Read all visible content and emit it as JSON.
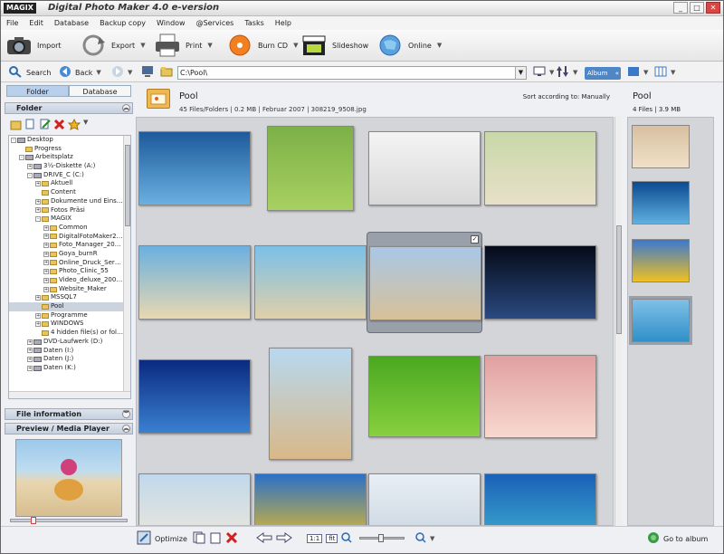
{
  "app": {
    "logo": "MAGIX",
    "title": "Digital Photo Maker 4.0 e-version",
    "controls": [
      "_",
      "□",
      "✕"
    ]
  },
  "menu": [
    "File",
    "Edit",
    "Database",
    "Backup copy",
    "Window",
    "@Services",
    "Tasks",
    "Help"
  ],
  "toolbar": {
    "import": "Import",
    "export": "Export",
    "print": "Print",
    "burn": "Burn CD",
    "slideshow": "Slideshow",
    "online": "Online"
  },
  "nav": {
    "search": "Search",
    "back": "Back",
    "path": "C:\\Pool\\",
    "album": "Album"
  },
  "left": {
    "tab_folder": "Folder",
    "tab_database": "Database",
    "folder_panel": "Folder",
    "file_info": "File information",
    "preview_panel": "Preview / Media Player"
  },
  "tree": [
    {
      "label": "Desktop",
      "d": 0,
      "t": "d",
      "e": "-"
    },
    {
      "label": "Progress",
      "d": 1,
      "t": "f",
      "e": ""
    },
    {
      "label": "Arbeitsplatz",
      "d": 1,
      "t": "d",
      "e": "-"
    },
    {
      "label": "3½-Diskette (A:)",
      "d": 2,
      "t": "r",
      "e": "+"
    },
    {
      "label": "DRIVE_C (C:)",
      "d": 2,
      "t": "r",
      "e": "-"
    },
    {
      "label": "Aktuell",
      "d": 3,
      "t": "f",
      "e": "+"
    },
    {
      "label": "Content",
      "d": 3,
      "t": "f",
      "e": ""
    },
    {
      "label": "Dokumente und Eins…",
      "d": 3,
      "t": "f",
      "e": "+"
    },
    {
      "label": "Fotos Präsi",
      "d": 3,
      "t": "f",
      "e": "+"
    },
    {
      "label": "MAGIX",
      "d": 3,
      "t": "f",
      "e": "-"
    },
    {
      "label": "Common",
      "d": 4,
      "t": "f",
      "e": "+"
    },
    {
      "label": "DigitalFotoMaker2…",
      "d": 4,
      "t": "f",
      "e": "+"
    },
    {
      "label": "Foto_Manager_20…",
      "d": 4,
      "t": "f",
      "e": "+"
    },
    {
      "label": "Goya_burnR",
      "d": 4,
      "t": "f",
      "e": "+"
    },
    {
      "label": "Online_Druck_Ser…",
      "d": 4,
      "t": "f",
      "e": "+"
    },
    {
      "label": "Photo_Clinic_55",
      "d": 4,
      "t": "f",
      "e": "+"
    },
    {
      "label": "Video_deluxe_200…",
      "d": 4,
      "t": "f",
      "e": "+"
    },
    {
      "label": "Website_Maker",
      "d": 4,
      "t": "f",
      "e": "+"
    },
    {
      "label": "MSSQL7",
      "d": 3,
      "t": "f",
      "e": "+"
    },
    {
      "label": "Pool",
      "d": 3,
      "t": "f",
      "e": "",
      "sel": true
    },
    {
      "label": "Programme",
      "d": 3,
      "t": "f",
      "e": "+"
    },
    {
      "label": "WINDOWS",
      "d": 3,
      "t": "f",
      "e": "+"
    },
    {
      "label": "4 hidden file(s) or fol…",
      "d": 3,
      "t": "f",
      "e": ""
    },
    {
      "label": "DVD-Laufwerk (D:)",
      "d": 2,
      "t": "r",
      "e": "+"
    },
    {
      "label": "Daten (I:)",
      "d": 2,
      "t": "r",
      "e": "+"
    },
    {
      "label": "Daten (J:)",
      "d": 2,
      "t": "r",
      "e": "+"
    },
    {
      "label": "Daten (K:)",
      "d": 2,
      "t": "r",
      "e": "+"
    }
  ],
  "main": {
    "folder": "Pool",
    "info": "45 Files/Folders | 0.2 MB | Februar 2007 | 308219_9508.jpg",
    "sort": "Sort according to: Manually",
    "checkmark": "✓"
  },
  "album": {
    "title": "Pool",
    "info": "4 Files | 3.9 MB"
  },
  "thumbs": [
    {
      "n": "dolphin",
      "c": "#1d5a9c",
      "c2": "#6ab0e0"
    },
    {
      "n": "sheep",
      "c": "#7cb048",
      "c2": "#a8d060"
    },
    {
      "n": "rose-bottle",
      "c": "#f4f4f4",
      "c2": "#d8d8d8"
    },
    {
      "n": "girl-grass",
      "c": "#c8d8a8",
      "c2": "#e8e0c8"
    },
    {
      "n": "beach",
      "c": "#6ab0e0",
      "c2": "#e8d8b0"
    },
    {
      "n": "family",
      "c": "#7ac0e8",
      "c2": "#e0d0a8"
    },
    {
      "n": "child-sand",
      "c": "#a8c8e8",
      "c2": "#d8c098"
    },
    {
      "n": "earth",
      "c": "#050a18",
      "c2": "#2a4a80"
    },
    {
      "n": "water-drop",
      "c": "#0a2a80",
      "c2": "#3a80d0"
    },
    {
      "n": "toddler-sand",
      "c": "#b8d8f0",
      "c2": "#d8b888"
    },
    {
      "n": "dog-lawn",
      "c": "#4aa820",
      "c2": "#88d040"
    },
    {
      "n": "baby",
      "c": "#e0a0a0",
      "c2": "#f8d8d0"
    },
    {
      "n": "kids-row4",
      "c": "#c0d8ec",
      "c2": "#f0e8d8"
    },
    {
      "n": "sunflower",
      "c": "#2a70c8",
      "c2": "#f0c020"
    },
    {
      "n": "clouds",
      "c": "#e8eef4",
      "c2": "#c8d4e0"
    },
    {
      "n": "palm-beach",
      "c": "#1a60b8",
      "c2": "#40b0d0"
    }
  ],
  "album_thumbs": [
    {
      "n": "kids-cake",
      "c": "#d8c0a0",
      "c2": "#f0e0c8"
    },
    {
      "n": "wave",
      "c": "#0a4a90",
      "c2": "#60b0e0"
    },
    {
      "n": "sunflower",
      "c": "#3a78d0",
      "c2": "#f0c020"
    },
    {
      "n": "sea",
      "c": "#80c0e8",
      "c2": "#3090c8"
    }
  ],
  "bottom": {
    "optimize": "Optimize",
    "fit11": "1:1",
    "fit": "fit",
    "go": "Go to album"
  }
}
